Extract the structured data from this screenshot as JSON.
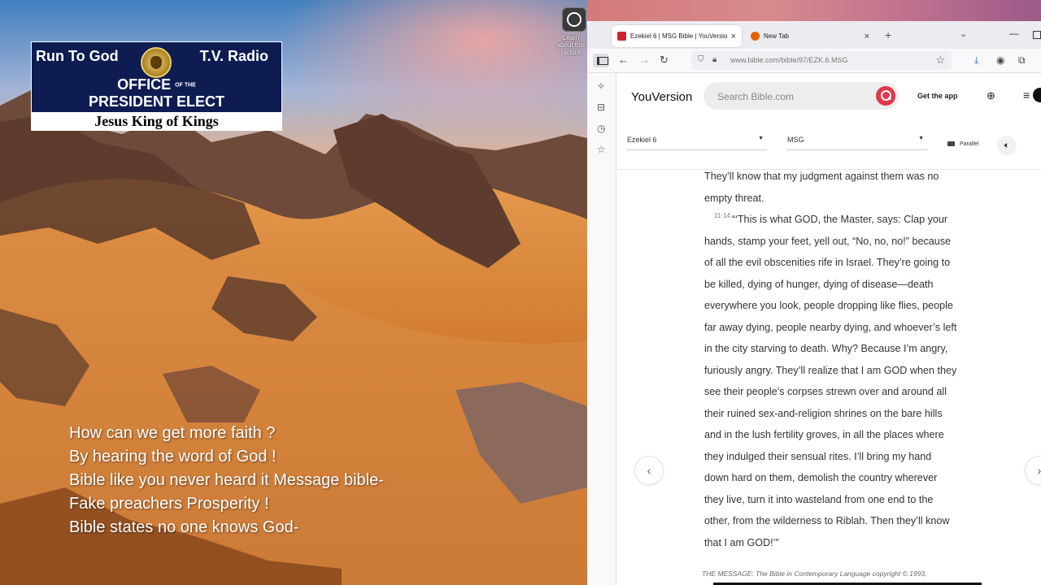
{
  "desktop": {
    "badge": {
      "left_text": "Run To God",
      "right_text": "T.V. Radio",
      "office_line1": "OFFICE",
      "office_of_the": "OF THE",
      "office_line2": "PRESIDENT ELECT",
      "bottom_text": "Jesus King of Kings"
    },
    "overlay_lines": [
      "How can we get more faith ?",
      "By hearing the word of God !",
      "Bible like you never heard it Message bible-",
      "Fake preachers  Prosperity !",
      "Bible states no one knows God-"
    ],
    "desktop_icon_label": "Learn about this picture"
  },
  "browser": {
    "tabs": [
      {
        "title": "Ezekiel 6 | MSG Bible | YouVersion",
        "favicon_color": "#c9252c",
        "active": true
      },
      {
        "title": "New Tab",
        "favicon_color": "#e66000",
        "active": false
      }
    ],
    "new_tab_symbol": "+",
    "url": "www.bible.com/bible/97/EZK.6.MSG"
  },
  "site": {
    "brand": "YouVersion",
    "search_placeholder": "Search Bible.com",
    "get_app": "Get the app",
    "book_selector": "Ezekiel 6",
    "version_selector": "MSG",
    "parallel_label": "Parallel",
    "verse_number": "11-14",
    "lines": [
      "They’ll know that my judgment against them was no",
      "empty threat.",
      "“‘This is what GOD, the Master, says: Clap your",
      "hands, stamp your feet, yell out, “No, no, no!” because",
      "of all the evil obscenities rife in Israel. They’re going to",
      "be killed, dying of hunger, dying of disease—death",
      "everywhere you look, people dropping like flies, people",
      "far away dying, people nearby dying, and whoever’s left",
      "in the city starving to death. Why? Because I’m angry,",
      "furiously angry. They’ll realize that I am GOD when they",
      "see their people’s corpses strewn over and around all",
      "their ruined sex-and-religion shrines on the bare hills",
      "and in the lush fertility groves, in all the places where",
      "they indulged their sensual rites. I’ll bring my hand",
      "down hard on them, demolish the country wherever",
      "they live, turn it into wasteland from one end to the",
      "other, from the wilderness to Riblah. Then they’ll know",
      "that I am GOD!’”"
    ],
    "copyright": "THE MESSAGE: The Bible in Contemporary Language copyright © 1993,",
    "accent_color": "#e0394a"
  }
}
